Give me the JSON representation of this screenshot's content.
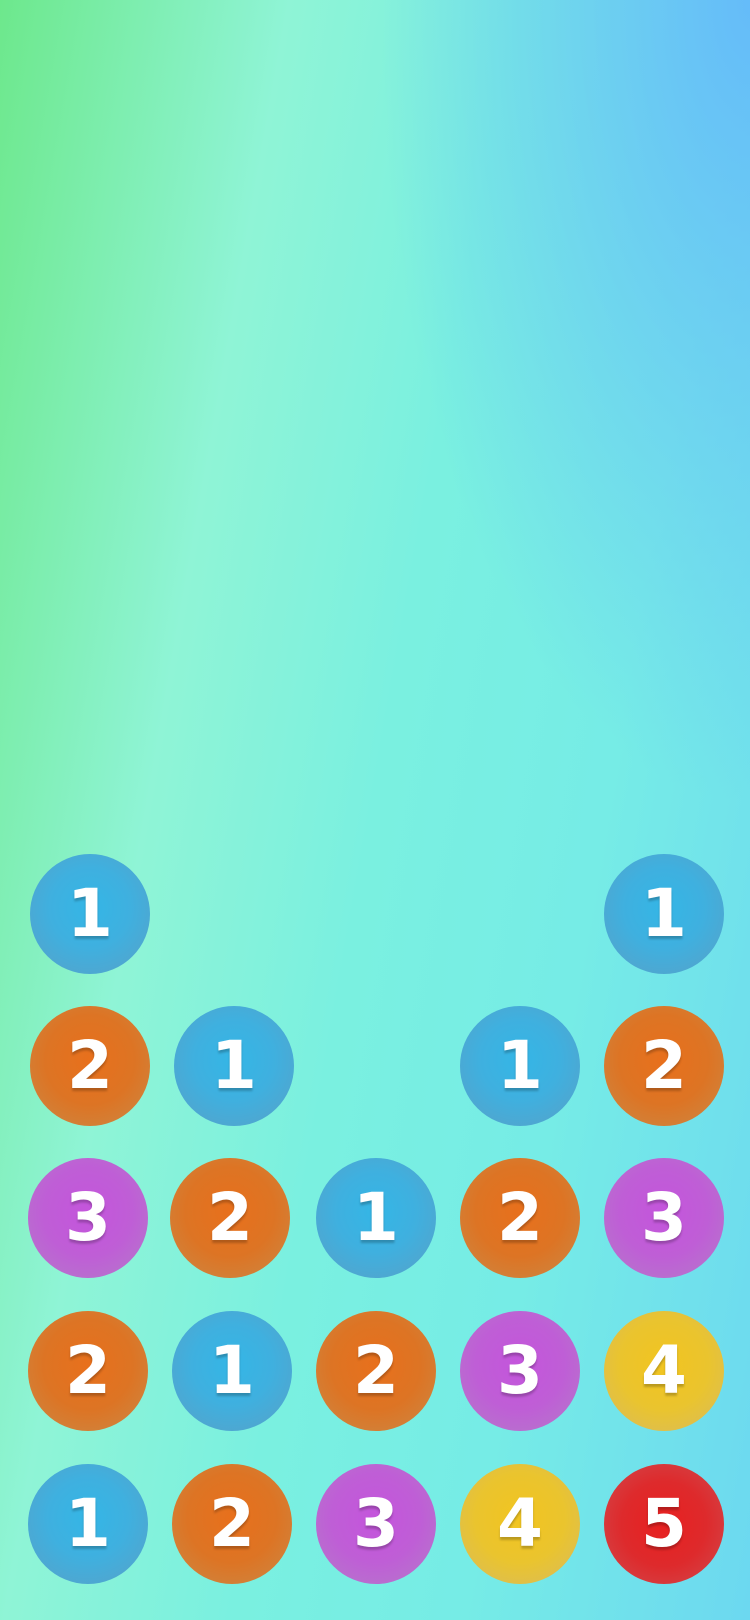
{
  "board": {
    "colors": {
      "1": "#3fb0df",
      "2": "#dd7424",
      "3": "#bf5ed6",
      "4": "#eac42e",
      "5": "#de2a2c"
    },
    "balls": [
      {
        "value": "1"
      },
      {
        "value": "1"
      },
      {
        "value": "2"
      },
      {
        "value": "1"
      },
      {
        "value": "1"
      },
      {
        "value": "2"
      },
      {
        "value": "3"
      },
      {
        "value": "2"
      },
      {
        "value": "1"
      },
      {
        "value": "2"
      },
      {
        "value": "3"
      },
      {
        "value": "2"
      },
      {
        "value": "1"
      },
      {
        "value": "2"
      },
      {
        "value": "3"
      },
      {
        "value": "4"
      },
      {
        "value": "1"
      },
      {
        "value": "2"
      },
      {
        "value": "3"
      },
      {
        "value": "4"
      },
      {
        "value": "5"
      }
    ]
  }
}
